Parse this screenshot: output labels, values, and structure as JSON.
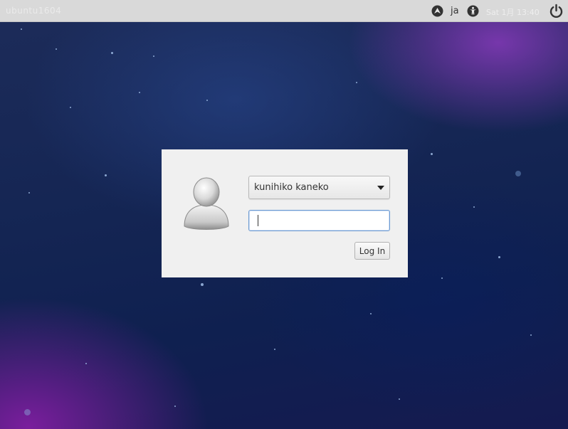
{
  "top_panel": {
    "hostname": "ubuntu1604",
    "language": "ja",
    "clock": "Sat 1月 13:40",
    "icons": [
      "network-icon",
      "accessibility-icon",
      "power-icon"
    ]
  },
  "login": {
    "selected_user": "kunihiko kaneko",
    "password_value": "",
    "password_placeholder": "",
    "login_button_label": "Log In"
  },
  "colors": {
    "panel_bg": "#d9d9d9",
    "dialog_bg": "#f0f0f0",
    "focus_border": "#6c9bd2",
    "wallpaper_base": "#142553",
    "wallpaper_accent": "#963cc8"
  }
}
